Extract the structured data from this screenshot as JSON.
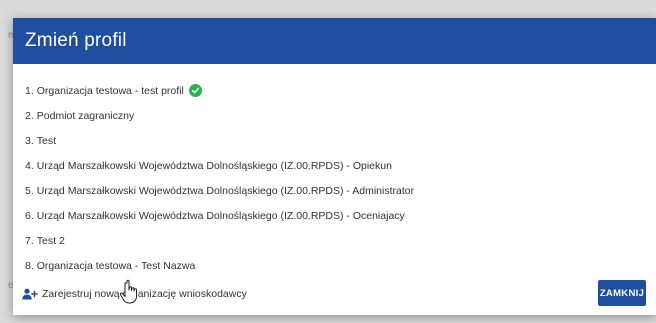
{
  "background": {
    "letters": [
      "m",
      "e"
    ]
  },
  "colors": {
    "header_bg": "#1f4ea0",
    "accent": "#1f4ea0",
    "check": "#2fb14d"
  },
  "modal": {
    "title": "Zmień profil",
    "profiles": [
      {
        "index": "1.",
        "label": "Organizacja testowa - test profil",
        "active": true,
        "icon": "check-circle-icon"
      },
      {
        "index": "2.",
        "label": "Podmiot zagraniczny"
      },
      {
        "index": "3.",
        "label": "Test"
      },
      {
        "index": "4.",
        "label": "Urząd Marszałkowski Województwa Dolnośląskiego (IZ.00.RPDS) - Opiekun"
      },
      {
        "index": "5.",
        "label": "Urząd Marszałkowski Województwa Dolnośląskiego (IZ.00.RPDS) - Administrator"
      },
      {
        "index": "6.",
        "label": "Urząd Marszałkowski Województwa Dolnośląskiego (IZ.00.RPDS) - Oceniajacy"
      },
      {
        "index": "7.",
        "label": "Test 2"
      },
      {
        "index": "8.",
        "label": "Organizacja testowa - Test Nazwa"
      }
    ],
    "footer": {
      "register_label": "Zarejestruj nową organizację wnioskodawcy",
      "register_icon": "user-plus-icon",
      "close_label": "ZAMKNIJ"
    }
  }
}
